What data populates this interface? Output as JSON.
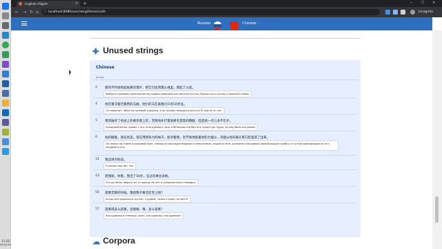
{
  "browser": {
    "tab_title": "Lingtrain Aligner",
    "url": "localhost:8080/user/zerg/items/ru/zh",
    "profile_label": "Incognito",
    "taskbar_time": "11:18",
    "taskbar_date": "04.02.2021"
  },
  "header": {
    "lang_from": "Russian",
    "lang_to": "Chinese"
  },
  "unused": {
    "title": "Unused strings",
    "card_title": "Chinese",
    "count_label": "8 lines",
    "rows": [
      {
        "num": "2",
        "zh": "那风不时地卷起枯黄的落叶，把它们投到篝火堆里，燃起了火焰。",
        "ru": "Время от времени сильный ветер срывал оморщенные желтые листья, бросал их в костер и зажигал пламя."
      },
      {
        "num": "4",
        "zh": "他在看守着行路用的马群，他们的马在离我们只有50步远。",
        "ru": "Он охраняет табун их кочевой упряжки, а их лагеря находятся всего в 50 шагах от нас."
      },
      {
        "num": "5",
        "zh": "寒风展开了他身上的褛衣襟上衣，无情地扑打着他那毛茸茸的胸膛，但是他一点儿也不在乎。",
        "ru": "Холодный ветер сорвал с его тела рубашку чеха и безжалостно бил его пушистую грудь, но ему было все равно."
      },
      {
        "num": "6",
        "zh": "他斜躺着，姿态优美，现在用那有力的样子，脸对着我，有节奏地吸着他的大烟斗，浓烟从他的鼻孔和口腔里冒了出来。",
        "ru": "Он лежал на спине в красивой позе, теперь он выглядел бодрым и энергичным, лицом ко мне, ритмично покуривая свою большую трубку, и густой дым выходил из его ноздрей и рта."
      },
      {
        "num": "12",
        "zh": "我这样对他说。",
        "ru": "Я сказал ему вот так."
      },
      {
        "num": "43",
        "zh": "而我呢，你看，我活了58岁，见过的事太多啦。",
        "ru": "Что до меня, видите ли, я прожил 58 лет и слишком много повидал."
      },
      {
        "num": "56",
        "zh": "寂寞无聊的时候，我想我干嘛活在世上呢？",
        "ru": "Когда мне одиноко и скучно, я думаю, зачем я живу на свете?"
      },
      {
        "num": "57",
        "zh": "寂寞得多么寂寞，连啊啊、咦、多么寂寞！",
        "ru": "Как одиноко в темнице, орел, как одиноко, как одиноко!"
      }
    ]
  },
  "corpora": {
    "title": "Corpora"
  },
  "colors": {
    "accent": "#2f6fc0",
    "card_bg": "#e6efff"
  }
}
